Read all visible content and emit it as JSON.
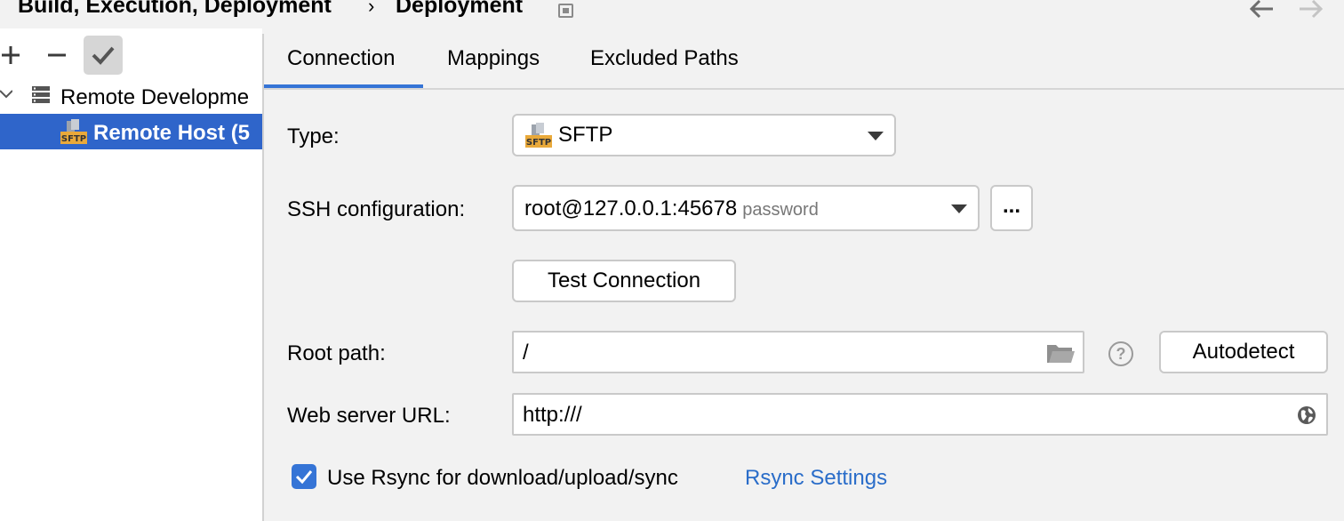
{
  "breadcrumb": {
    "parent": "Build, Execution, Deployment",
    "separator": "›",
    "current": "Deployment"
  },
  "tree": {
    "group_label": "Remote Developme",
    "selected_label": "Remote Host (5"
  },
  "tabs": [
    {
      "label": "Connection",
      "active": true
    },
    {
      "label": "Mappings",
      "active": false
    },
    {
      "label": "Excluded Paths",
      "active": false
    }
  ],
  "form": {
    "type_label": "Type:",
    "type_value": "SFTP",
    "ssh_label": "SSH configuration:",
    "ssh_value": "root@127.0.0.1:45678",
    "ssh_hint": "password",
    "browse_label": "...",
    "test_connection_label": "Test Connection",
    "root_label": "Root path:",
    "root_value": "/",
    "help_label": "?",
    "autodetect_label": "Autodetect",
    "web_label": "Web server URL:",
    "web_value": "http:///",
    "rsync_checkbox_label": "Use Rsync for download/upload/sync",
    "rsync_checked": true,
    "rsync_link": "Rsync Settings"
  },
  "icons": {
    "sftp_badge_text": "SFTP"
  },
  "colors": {
    "accent": "#3574d6",
    "selection": "#2f65ca",
    "link": "#2a6dc9",
    "sftp_badge": "#e9a93a"
  }
}
